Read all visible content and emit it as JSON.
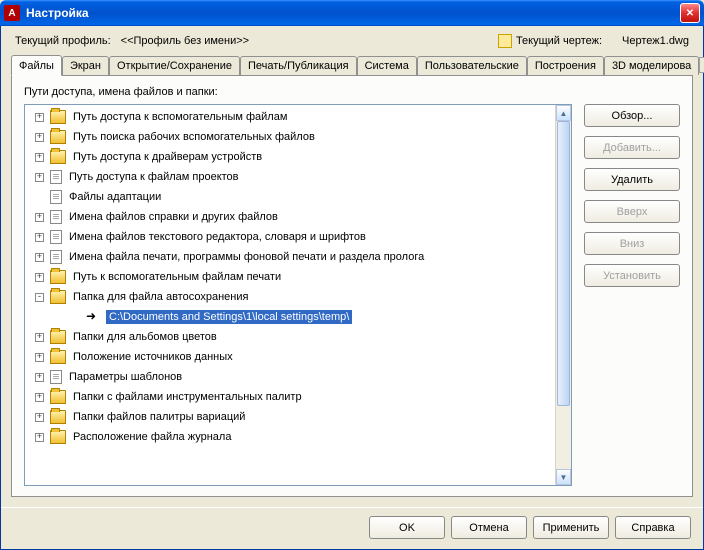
{
  "titlebar": {
    "title": "Настройка",
    "app_letter": "A"
  },
  "profile": {
    "label": "Текущий профиль:",
    "value": "<<Профиль без имени>>",
    "drawing_label": "Текущий чертеж:",
    "drawing_value": "Чертеж1.dwg"
  },
  "tabs": {
    "items": [
      {
        "label": "Файлы",
        "active": true
      },
      {
        "label": "Экран"
      },
      {
        "label": "Открытие/Сохранение"
      },
      {
        "label": "Печать/Публикация"
      },
      {
        "label": "Система"
      },
      {
        "label": "Пользовательские"
      },
      {
        "label": "Построения"
      },
      {
        "label": "3D моделирова"
      }
    ]
  },
  "panel": {
    "heading": "Пути доступа, имена файлов и папки:"
  },
  "tree": [
    {
      "icon": "folder",
      "exp": "+",
      "label": "Путь доступа к вспомогательным файлам"
    },
    {
      "icon": "folder",
      "exp": "+",
      "label": "Путь поиска рабочих вспомогательных файлов"
    },
    {
      "icon": "folder",
      "exp": "+",
      "label": "Путь доступа к драйверам устройств"
    },
    {
      "icon": "file",
      "exp": "+",
      "label": "Путь доступа к файлам проектов"
    },
    {
      "icon": "file",
      "exp": "",
      "label": "Файлы адаптации"
    },
    {
      "icon": "file",
      "exp": "+",
      "label": "Имена файлов справки и других файлов"
    },
    {
      "icon": "file",
      "exp": "+",
      "label": "Имена файлов текстового редактора, словаря и шрифтов"
    },
    {
      "icon": "file",
      "exp": "+",
      "label": "Имена файла печати, программы фоновой печати и раздела пролога"
    },
    {
      "icon": "folder",
      "exp": "+",
      "label": "Путь к вспомогательным файлам печати"
    },
    {
      "icon": "folder",
      "exp": "-",
      "label": "Папка для файла автосохранения",
      "children": [
        {
          "icon": "arrow",
          "label": "C:\\Documents and Settings\\1\\local settings\\temp\\",
          "selected": true
        }
      ]
    },
    {
      "icon": "folder",
      "exp": "+",
      "label": "Папки для альбомов цветов"
    },
    {
      "icon": "folder",
      "exp": "+",
      "label": "Положение источников данных"
    },
    {
      "icon": "file",
      "exp": "+",
      "label": "Параметры шаблонов"
    },
    {
      "icon": "folder",
      "exp": "+",
      "label": "Папки с файлами инструментальных палитр"
    },
    {
      "icon": "folder",
      "exp": "+",
      "label": "Папки файлов палитры вариаций"
    },
    {
      "icon": "folder",
      "exp": "+",
      "label": "Расположение файла журнала"
    }
  ],
  "side_buttons": [
    {
      "label": "Обзор...",
      "enabled": true
    },
    {
      "label": "Добавить...",
      "enabled": false
    },
    {
      "label": "Удалить",
      "enabled": true
    },
    {
      "label": "Вверх",
      "enabled": false
    },
    {
      "label": "Вниз",
      "enabled": false
    },
    {
      "label": "Установить",
      "enabled": false
    }
  ],
  "bottom_buttons": {
    "ok": "OK",
    "cancel": "Отмена",
    "apply": "Применить",
    "help": "Справка"
  }
}
